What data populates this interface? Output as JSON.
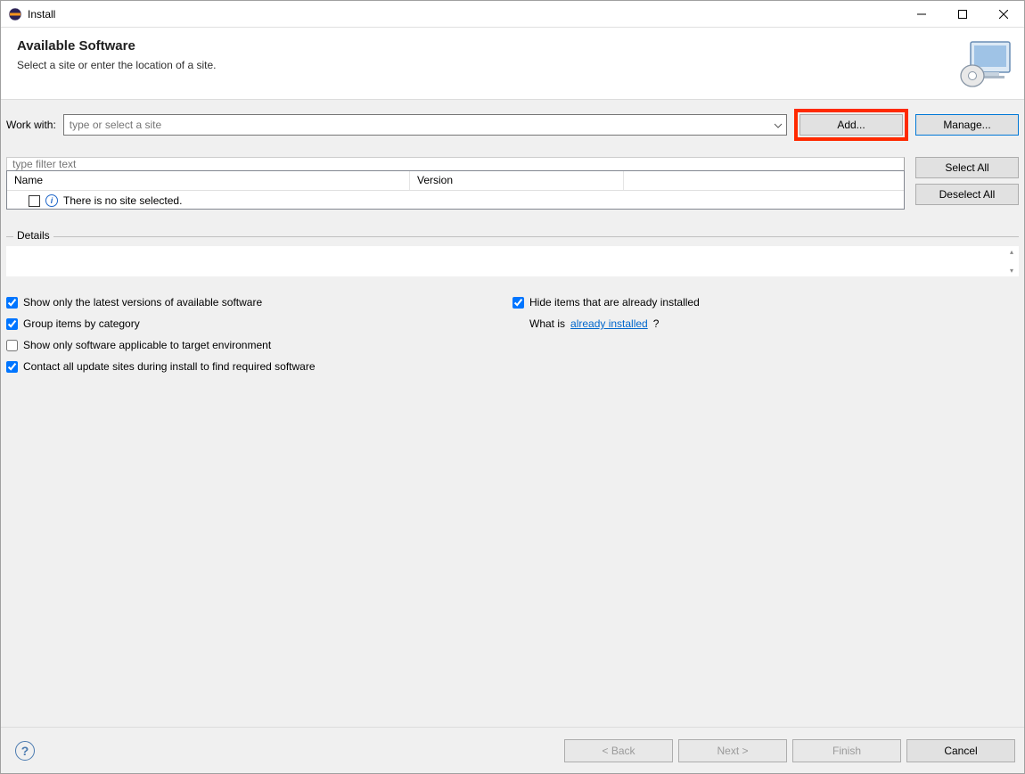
{
  "window": {
    "title": "Install"
  },
  "banner": {
    "title": "Available Software",
    "subtitle": "Select a site or enter the location of a site."
  },
  "workwith": {
    "label": "Work with:",
    "placeholder": "type or select a site",
    "add_label": "Add...",
    "manage_label": "Manage..."
  },
  "filter": {
    "placeholder": "type filter text"
  },
  "side_buttons": {
    "select_all": "Select All",
    "deselect_all": "Deselect All"
  },
  "table": {
    "col_name": "Name",
    "col_version": "Version",
    "empty_message": "There is no site selected."
  },
  "details": {
    "legend": "Details"
  },
  "options": {
    "latest_versions": "Show only the latest versions of available software",
    "hide_installed": "Hide items that are already installed",
    "group_by_category": "Group items by category",
    "what_is_prefix": "What is ",
    "already_installed_link": "already installed",
    "what_is_suffix": "?",
    "applicable_target": "Show only software applicable to target environment",
    "contact_all_sites": "Contact all update sites during install to find required software"
  },
  "footer": {
    "back": "< Back",
    "next": "Next >",
    "finish": "Finish",
    "cancel": "Cancel"
  },
  "checked": {
    "latest_versions": true,
    "hide_installed": true,
    "group_by_category": true,
    "applicable_target": false,
    "contact_all_sites": true
  }
}
